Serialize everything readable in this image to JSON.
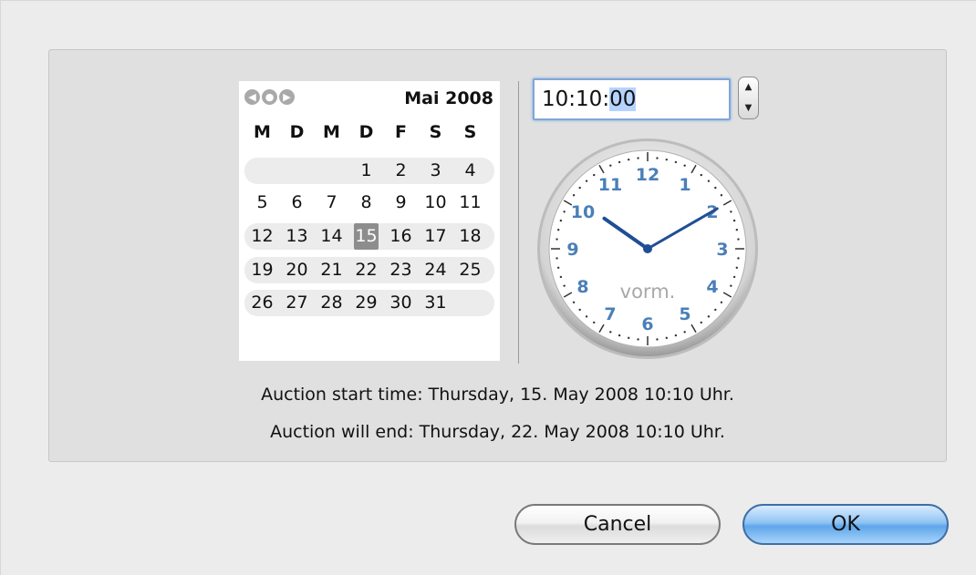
{
  "calendar": {
    "title": "Mai 2008",
    "nav": [
      "◀",
      "●",
      "▶"
    ],
    "weekdays": [
      "M",
      "D",
      "M",
      "D",
      "F",
      "S",
      "S"
    ],
    "weeks": [
      [
        "",
        "",
        "",
        "1",
        "2",
        "3",
        "4"
      ],
      [
        "5",
        "6",
        "7",
        "8",
        "9",
        "10",
        "11"
      ],
      [
        "12",
        "13",
        "14",
        "15",
        "16",
        "17",
        "18"
      ],
      [
        "19",
        "20",
        "21",
        "22",
        "23",
        "24",
        "25"
      ],
      [
        "26",
        "27",
        "28",
        "29",
        "30",
        "31",
        ""
      ]
    ],
    "selected_day": "15"
  },
  "time": {
    "hours": "10",
    "minutes": "10",
    "seconds": "00",
    "stepper_up": "▲",
    "stepper_down": "▼"
  },
  "clock": {
    "numbers": [
      "12",
      "1",
      "2",
      "3",
      "4",
      "5",
      "6",
      "7",
      "8",
      "9",
      "10",
      "11"
    ],
    "period_label": "vorm.",
    "hour": 10,
    "minute": 10
  },
  "status": {
    "start": "Auction start time: Thursday, 15. May 2008 10:10 Uhr.",
    "end": "Auction will end: Thursday, 22. May 2008 10:10 Uhr."
  },
  "buttons": {
    "cancel": "Cancel",
    "ok": "OK"
  },
  "colors": {
    "clock_numbers": "#4a7fb8",
    "hands": "#1e4f95",
    "selection": "#b5d3ff",
    "default_button": "#5ea6ea"
  }
}
